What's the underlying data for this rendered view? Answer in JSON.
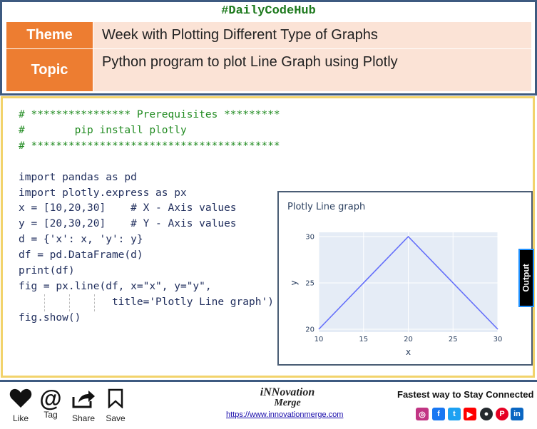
{
  "header": {
    "hashtag": "#DailyCodeHub",
    "theme_label": "Theme",
    "theme_value": "Week with Plotting Different Type of Graphs",
    "topic_label": "Topic",
    "topic_value": "Python program to plot Line Graph using Plotly"
  },
  "code_lines": [
    "# **************** Prerequisites *********",
    "#        pip install plotly",
    "# ****************************************",
    "",
    "import pandas as pd",
    "import plotly.express as px",
    "x = [10,20,30]    # X - Axis values",
    "y = [20,30,20]    # Y - Axis values",
    "d = {'x': x, 'y': y}",
    "df = pd.DataFrame(d)",
    "print(df)",
    "fig = px.line(df, x=\"x\", y=\"y\",",
    "               title='Plotly Line graph')",
    "fig.show()"
  ],
  "output_tab": "Output",
  "chart_data": {
    "type": "line",
    "title": "Plotly Line graph",
    "x": [
      10,
      20,
      30
    ],
    "y": [
      20,
      30,
      20
    ],
    "xlabel": "x",
    "ylabel": "y",
    "xlim": [
      10,
      30
    ],
    "ylim": [
      20,
      30
    ],
    "xticks": [
      10,
      15,
      20,
      25,
      30
    ],
    "yticks": [
      20,
      25,
      30
    ],
    "grid": true,
    "line_color": "#636efa",
    "plot_bg": "#e5ecf6"
  },
  "footer": {
    "actions": [
      {
        "label": "Like",
        "icon": "heart-icon"
      },
      {
        "label": "Tag",
        "icon": "at-icon"
      },
      {
        "label": "Share",
        "icon": "share-icon"
      },
      {
        "label": "Save",
        "icon": "bookmark-icon"
      }
    ],
    "brand_line1": "iNNovation",
    "brand_line2": "Merge",
    "url": "https://www.innovationmerge.com",
    "tagline": "Fastest way to Stay Connected",
    "social_icons": [
      "instagram-icon",
      "facebook-icon",
      "twitter-icon",
      "youtube-icon",
      "github-icon",
      "pinterest-icon",
      "linkedin-icon"
    ]
  }
}
